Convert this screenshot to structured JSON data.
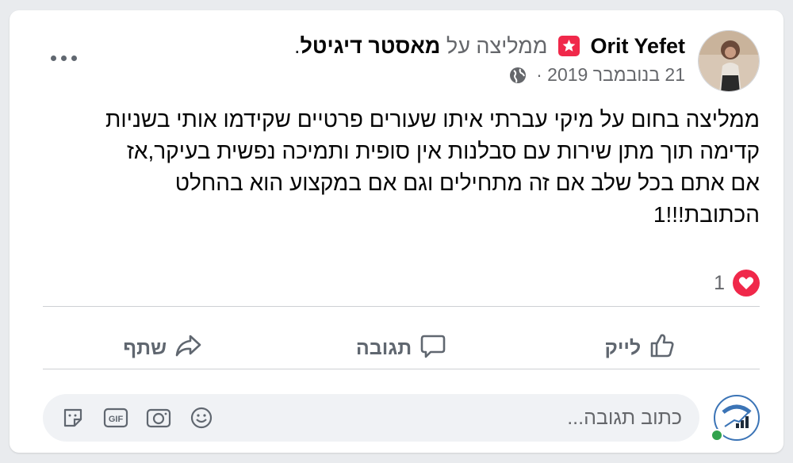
{
  "post": {
    "author": "Orit Yefet",
    "recommends_text": "ממליצה על",
    "page_name": "מאסטר דיגיטל",
    "trailing": ".",
    "date": "21 בנובמבר 2019",
    "date_separator": "·",
    "body": "ממליצה בחום על מיקי עברתי איתו שעורים פרטיים שקידמו אותי בשניות\nקדימה תוך מתן שירות עם סבלנות אין סופית ותמיכה נפשית בעיקר,אז\nאם אתם בכל שלב אם זה מתחילים וגם אם במקצוע הוא בהחלט\nהכתובת!!!1"
  },
  "reactions": {
    "count": "1",
    "type": "heart-icon"
  },
  "actions": {
    "like_label": "לייק",
    "comment_label": "תגובה",
    "share_label": "שתף"
  },
  "comment": {
    "placeholder": "כתוב תגובה...",
    "icons": [
      "emoji-icon",
      "camera-icon",
      "gif-icon",
      "sticker-icon"
    ]
  },
  "colors": {
    "recommend_badge": "#f0284a",
    "heart": "#f0284a",
    "online": "#31a24c",
    "muted_text": "#65676b"
  }
}
